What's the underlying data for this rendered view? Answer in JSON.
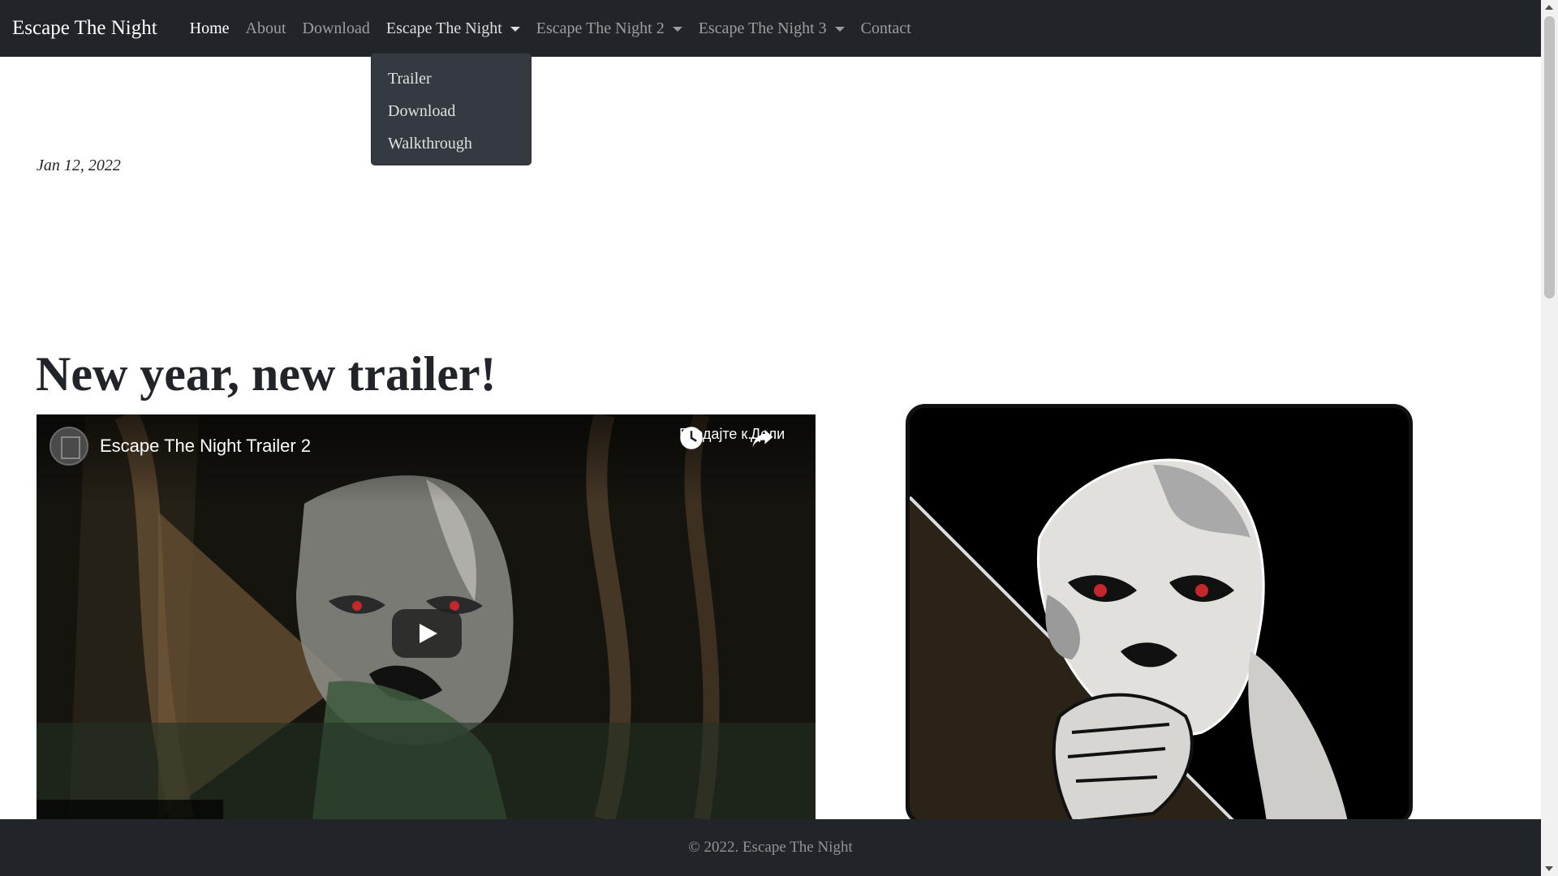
{
  "navbar": {
    "brand": "Escape The Night",
    "items": [
      {
        "label": "Home",
        "active": true
      },
      {
        "label": "About"
      },
      {
        "label": "Download"
      },
      {
        "label": "Escape The Night",
        "dropdown": true,
        "open": true
      },
      {
        "label": "Escape The Night 2",
        "dropdown": true
      },
      {
        "label": "Escape The Night 3",
        "dropdown": true
      },
      {
        "label": "Contact"
      }
    ],
    "dropdown_items": [
      "Trailer",
      "Download",
      "Walkthrough"
    ]
  },
  "post": {
    "date": "Jan 12, 2022",
    "title": "New year, new trailer!"
  },
  "video": {
    "title": "Escape The Night Trailer 2",
    "watch_later_label": "Гледајте к...",
    "share_label": "Дели",
    "watch_later_icon": "clock-icon",
    "share_icon": "share-icon"
  },
  "footer": {
    "text": "© 2022. Escape The Night"
  },
  "colors": {
    "navbar_bg": "#212529",
    "dropdown_bg": "#343a40",
    "eye_red": "#c1272d"
  }
}
